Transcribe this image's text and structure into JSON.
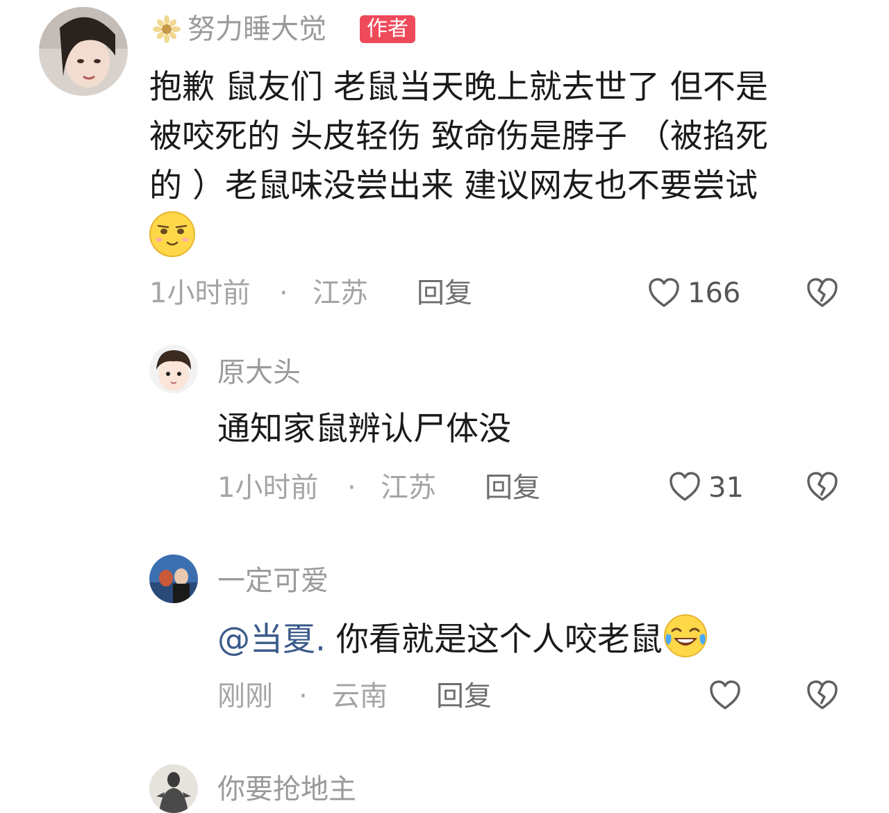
{
  "comments": [
    {
      "username": "努力睡大觉",
      "badge": "作者",
      "text_lines": [
        "抱歉 鼠友们 老鼠当天晚上就去世了 但不是",
        "被咬死的 头皮轻伤 致命伤是脖子 （被掐死",
        "的 ）老鼠味没尝出来 建议网友也不要尝试"
      ],
      "emoji": "smirk-face-emoji",
      "time": "1小时前",
      "location": "江苏",
      "reply_label": "回复",
      "likes": "166"
    },
    {
      "username": "原大头",
      "text": "通知家鼠辨认尸体没",
      "time": "1小时前",
      "location": "江苏",
      "reply_label": "回复",
      "likes": "31"
    },
    {
      "username": "一定可爱",
      "mention": "@当夏.",
      "text": " 你看就是这个人咬老鼠",
      "emoji": "tears-of-joy-emoji",
      "time": "刚刚",
      "location": "云南",
      "reply_label": "回复",
      "likes": ""
    },
    {
      "username": "你要抢地主"
    }
  ],
  "meta_separator": "·",
  "icons": {
    "like": "heart-outline-icon",
    "dislike": "broken-heart-icon",
    "username_prefix": "sunflower-icon"
  },
  "colors": {
    "badge": "#ef4a5a",
    "mention": "#3a5a8a",
    "muted_text": "#9a9a9a"
  }
}
